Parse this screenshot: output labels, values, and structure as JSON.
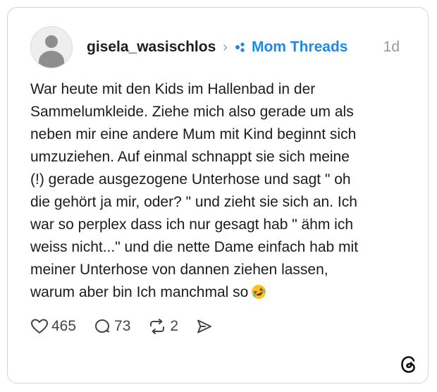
{
  "post": {
    "username": "gisela_wasischlos",
    "topic": "Mom Threads",
    "time": "1d",
    "text": "War heute mit den Kids im Hallenbad in der\nSammelumkleide. Ziehe mich also gerade um als\nneben mir eine andere Mum mit Kind beginnt sich\numzuziehen. Auf einmal schnappt sie sich meine\n(!) gerade ausgezogene Unterhose und sagt \" oh\ndie gehört ja mir, oder? \" und zieht sie sich an. Ich\nwar so perplex dass ich nur gesagt hab \" ähm ich\nweiss nicht...\" und die nette Dame einfach hab mit\nmeiner Unterhose von dannen ziehen lassen,\nwarum aber bin Ich manchmal so",
    "emoji": "rolling-on-floor-laughing-emoji",
    "likes": "465",
    "replies": "73",
    "reposts": "2"
  },
  "icons": {
    "separator": "chevron-right-icon",
    "topic": "topic-dots-icon",
    "like": "heart-icon",
    "reply": "comment-icon",
    "repost": "repost-icon",
    "share": "send-icon",
    "brand": "threads-logo-icon"
  },
  "colors": {
    "topic": "#1e88e5",
    "text": "#1c1c1c",
    "muted": "#9a9a9a",
    "border": "#d4d4d4"
  }
}
